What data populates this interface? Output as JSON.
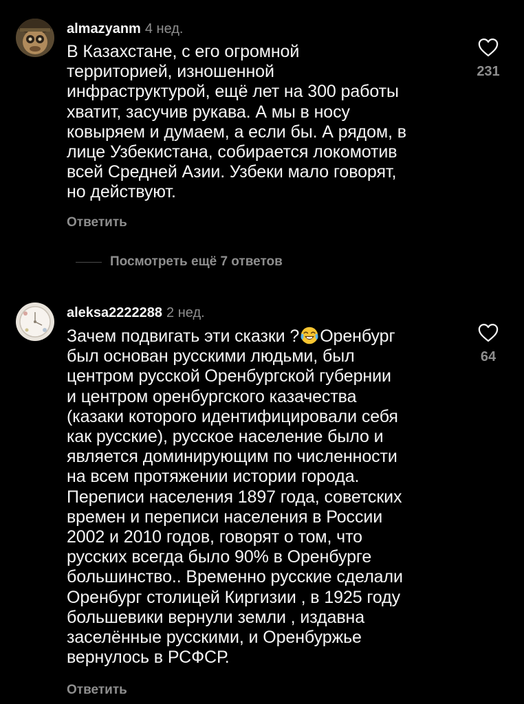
{
  "theme": {
    "background": "#000000",
    "text_primary": "#f5f5f5",
    "text_secondary": "#8e8e8e"
  },
  "comments": [
    {
      "username": "almazyanm",
      "time": "4 нед.",
      "text": "В Казахстане, с его огромной\nтерриторией, изношенной\nинфраструктурой, ещё лет на 300 работы\nхватит, засучив рукава. А мы в носу\nковыряем и думаем, а если бы. А рядом, в\nлице Узбекистана, собирается локомотив\nвсей Средней Азии. Узбеки мало говорят,\nно действуют.",
      "likes": "231",
      "reply_label": "Ответить",
      "like_icon": "heart-outline-icon"
    },
    {
      "username": "aleksa2222288",
      "time": "2 нед.",
      "text_before_emoji": "Зачем подвигать эти сказки ?",
      "emoji": "face-with-tears-of-joy",
      "text_after_emoji": "Оренбург\nбыл основан русскими людьми, был\nцентром русской Оренбургской губернии\nи центром оренбургского казачества\n(казаки которого идентифицировали себя\nкак русские), русское население было и\nявляется доминирующим по численности\nна всем протяжении истории города.\nПереписи населения 1897 года, советских\nвремен и переписи населения в России\n2002 и 2010 годов, говорят о том, что\nрусских всегда было 90% в Оренбурге\nбольшинство.. Временно русские сделали\nОренбург столицей Киргизии , в 1925 году\nбольшевики  вернули земли , издавна\nзаселённые русскими, и Оренбуржье\nвернулось в РСФСР.",
      "likes": "64",
      "reply_label": "Ответить",
      "like_icon": "heart-outline-icon"
    }
  ],
  "view_replies": {
    "label": "Посмотреть ещё 7 ответов"
  }
}
